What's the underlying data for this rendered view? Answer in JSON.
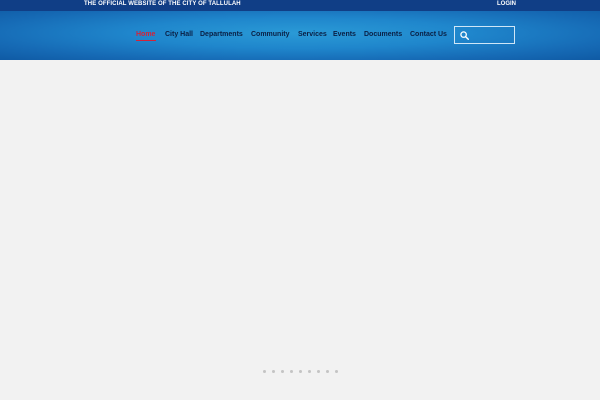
{
  "topbar": {
    "official_text": "THE OFFICIAL WEBSITE OF THE CITY OF TALLULAH",
    "login_label": "LOGIN"
  },
  "nav": {
    "items": [
      {
        "label": "Home",
        "active": true
      },
      {
        "label": "City Hall"
      },
      {
        "label": "Departments"
      },
      {
        "label": "Community"
      },
      {
        "label": "Services"
      },
      {
        "label": "Events"
      },
      {
        "label": "Documents"
      },
      {
        "label": "Contact Us"
      }
    ]
  },
  "search": {
    "icon": "search-icon",
    "value": "",
    "placeholder": ""
  },
  "carousel": {
    "slide_count": 9
  },
  "colors": {
    "topbar": "#103e86",
    "header": "#1f86cc",
    "active_nav": "#d2233a",
    "nav_text": "#0a1f44",
    "background": "#f2f2f2",
    "dot": "#c4c4c4"
  }
}
